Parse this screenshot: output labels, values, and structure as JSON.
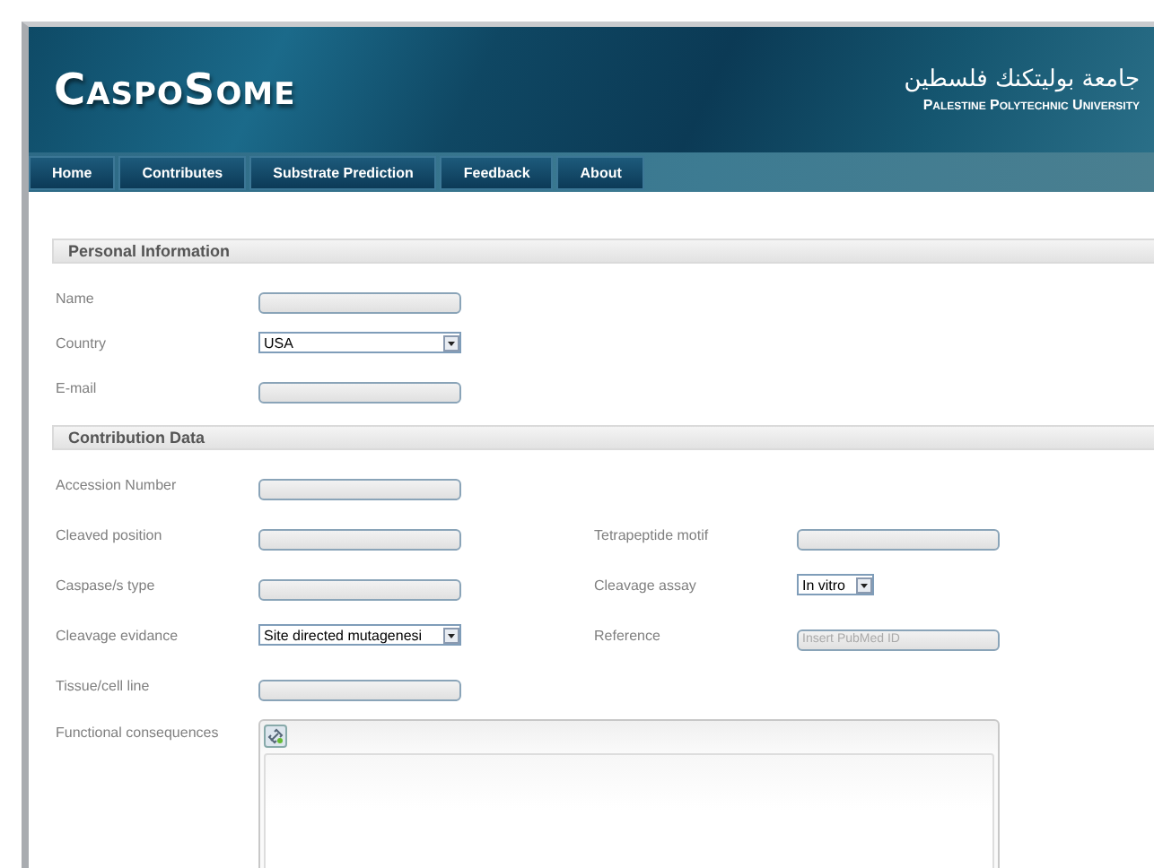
{
  "header": {
    "logo": "CaspoSome",
    "university_arabic": "جامعة بوليتكنك فلسطين",
    "university": "Palestine Polytechnic University"
  },
  "nav": [
    {
      "label": "Home"
    },
    {
      "label": "Contributes"
    },
    {
      "label": "Substrate Prediction"
    },
    {
      "label": "Feedback"
    },
    {
      "label": "About"
    }
  ],
  "sections": [
    {
      "title": "Personal Information",
      "rows": [
        {
          "cells": [
            {
              "kind": "input",
              "label": "Name"
            }
          ]
        },
        {
          "cells": [
            {
              "kind": "select",
              "label": "Country",
              "value": "USA"
            }
          ]
        },
        {
          "cells": [
            {
              "kind": "input",
              "label": "E-mail"
            }
          ]
        }
      ]
    },
    {
      "title": "Contribution Data",
      "rows": [
        {
          "cells": [
            {
              "kind": "input",
              "label": "Accession Number"
            }
          ]
        },
        {
          "cells": [
            {
              "kind": "input",
              "label": "Cleaved position"
            },
            {
              "kind": "input",
              "label": "Tetrapeptide motif"
            }
          ]
        },
        {
          "cells": [
            {
              "kind": "input",
              "label": "Caspase/s type"
            },
            {
              "kind": "select",
              "label": "Cleavage assay",
              "value": "In vitro"
            }
          ]
        },
        {
          "cells": [
            {
              "kind": "select",
              "label": "Cleavage evidance",
              "value": "Site directed mutagenesi"
            },
            {
              "kind": "input",
              "label": "Reference",
              "placeholder": "Insert PubMed ID"
            }
          ]
        },
        {
          "cells": [
            {
              "kind": "input",
              "label": "Tissue/cell line"
            }
          ]
        },
        {
          "cells": [
            {
              "kind": "editor",
              "label": "Functional consequences"
            }
          ]
        }
      ]
    }
  ]
}
